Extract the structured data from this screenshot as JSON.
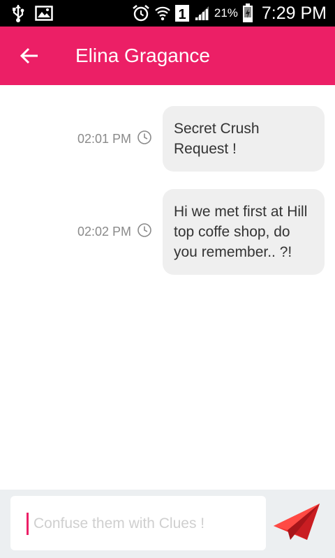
{
  "status_bar": {
    "battery_percent": "21%",
    "time": "7:29 PM",
    "sim_slot": "1",
    "icons": [
      "usb-icon",
      "image-icon",
      "alarm-icon",
      "wifi-icon",
      "sim-icon",
      "signal-icon",
      "battery-icon"
    ]
  },
  "app_bar": {
    "title": "Elina Gragance",
    "background": "#ec1f66",
    "back_icon": "arrow-left-icon"
  },
  "messages": [
    {
      "time": "02:01 PM",
      "text": "Secret Crush Request !"
    },
    {
      "time": "02:02 PM",
      "text": "Hi we met first at Hill top coffe shop, do you remember.. ?!"
    }
  ],
  "composer": {
    "value": "",
    "placeholder": "Confuse them with Clues !",
    "send_icon": "paper-plane-icon",
    "accent": "#f0302f"
  }
}
